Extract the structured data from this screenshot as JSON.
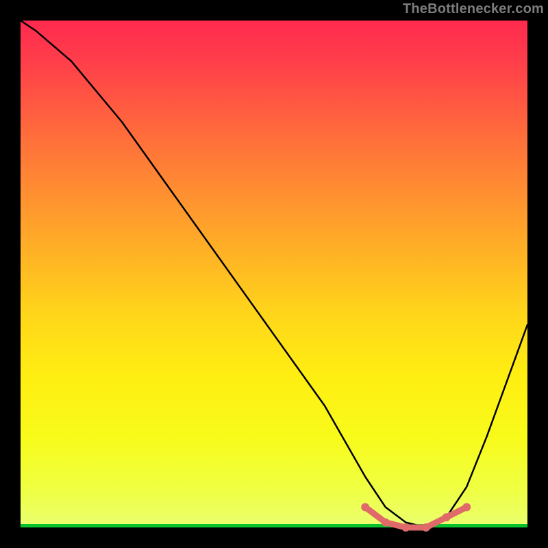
{
  "attribution": "TheBottlenecker.com",
  "chart_data": {
    "type": "line",
    "title": "",
    "xlabel": "",
    "ylabel": "",
    "xlim": [
      0,
      100
    ],
    "ylim": [
      0,
      100
    ],
    "series": [
      {
        "name": "bottleneck-curve",
        "x": [
          0,
          3,
          10,
          20,
          30,
          40,
          50,
          60,
          68,
          72,
          76,
          80,
          84,
          88,
          92,
          100
        ],
        "values": [
          100,
          98,
          92,
          80,
          66,
          52,
          38,
          24,
          10,
          4,
          1,
          0,
          2,
          8,
          18,
          40
        ]
      }
    ],
    "highlight": {
      "name": "optimal-range",
      "x": [
        68,
        72,
        76,
        80,
        84,
        88
      ],
      "values": [
        4,
        1,
        0,
        0,
        2,
        4
      ]
    },
    "gradient_stops": [
      {
        "pos": 0.0,
        "color": "#ff2a4f"
      },
      {
        "pos": 0.5,
        "color": "#ffd61a"
      },
      {
        "pos": 0.95,
        "color": "#f0ff40"
      },
      {
        "pos": 1.0,
        "color": "#06c22e"
      }
    ]
  }
}
